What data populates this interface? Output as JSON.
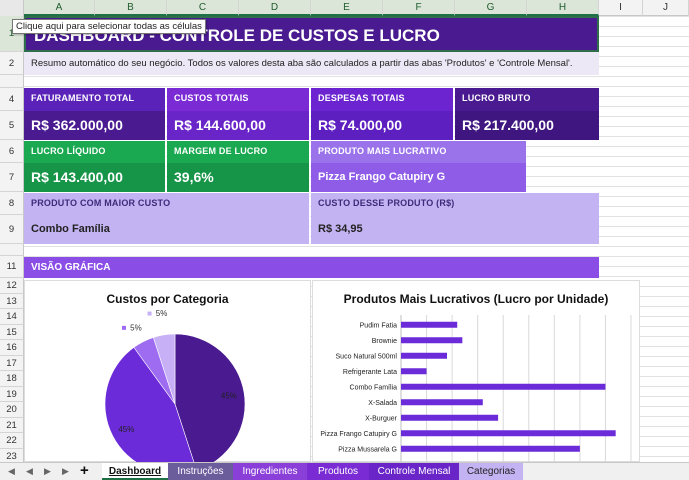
{
  "tooltip": "Clique aqui para selecionar todas as células",
  "columns": [
    "A",
    "B",
    "C",
    "D",
    "E",
    "F",
    "G",
    "H",
    "I",
    "J"
  ],
  "rows": [
    "1",
    "2",
    "4",
    "5",
    "6",
    "7",
    "8",
    "9",
    "11",
    "12",
    "13",
    "14",
    "15",
    "16",
    "17",
    "18",
    "19",
    "20",
    "21",
    "22",
    "23",
    "24"
  ],
  "dashboard": {
    "title": "DASHBOARD - CONTROLE DE CUSTOS E LUCRO",
    "subtitle": "Resumo automático do seu negócio. Todos os valores desta aba são calculados a partir das abas 'Produtos' e 'Controle Mensal'.",
    "kpis": [
      {
        "label": "FATURAMENTO TOTAL",
        "value": "R$ 362.000,00"
      },
      {
        "label": "CUSTOS TOTAIS",
        "value": "R$ 144.600,00"
      },
      {
        "label": "DESPESAS TOTAIS",
        "value": "R$ 74.000,00"
      },
      {
        "label": "LUCRO BRUTO",
        "value": "R$ 217.400,00"
      },
      {
        "label": "LUCRO LÍQUIDO",
        "value": "R$ 143.400,00"
      },
      {
        "label": "MARGEM DE LUCRO",
        "value": "39,6%"
      },
      {
        "label": "PRODUTO MAIS LUCRATIVO",
        "value": "Pizza Frango Catupiry G"
      },
      {
        "label": "PRODUTO COM MAIOR CUSTO",
        "value": "Combo Família"
      },
      {
        "label": "CUSTO DESSE PRODUTO (R$)",
        "value": "R$ 34,95"
      }
    ],
    "section_title": "VISÃO GRÁFICA"
  },
  "chart_data": [
    {
      "type": "pie",
      "title": "Custos por Categoria",
      "slices": [
        {
          "value": 45,
          "label": "45%",
          "color": "#4a1a91"
        },
        {
          "value": 45,
          "label": "45%",
          "color": "#6c2bd9"
        },
        {
          "value": 5,
          "label": "5%",
          "color": "#9d6cf0"
        },
        {
          "value": 5,
          "label": "5%",
          "color": "#c8b0f7"
        }
      ]
    },
    {
      "type": "bar",
      "orientation": "horizontal",
      "title": "Produtos Mais Lucrativos (Lucro por Unidade)",
      "categories": [
        "Pudim Fatia",
        "Brownie",
        "Suco Natural 500ml",
        "Refrigerante Lata",
        "Combo Família",
        "X-Salada",
        "X-Burguer",
        "Pizza Frango Catupiry G",
        "Pizza Mussarela G"
      ],
      "values": [
        11,
        12,
        9,
        5,
        40,
        16,
        19,
        42,
        35
      ],
      "xlim": [
        0,
        45
      ],
      "grid": true,
      "color": "#6c2bd9"
    }
  ],
  "tabs": [
    "Dashboard",
    "Instruções",
    "Ingredientes",
    "Produtos",
    "Controle Mensal",
    "Categorias"
  ],
  "tab_colors": [
    "#ffffff",
    "#6b5c9c",
    "#8b3fd9",
    "#7a2bd4",
    "#6a25c8",
    "#c4b3f2"
  ],
  "add_sheet": "+"
}
